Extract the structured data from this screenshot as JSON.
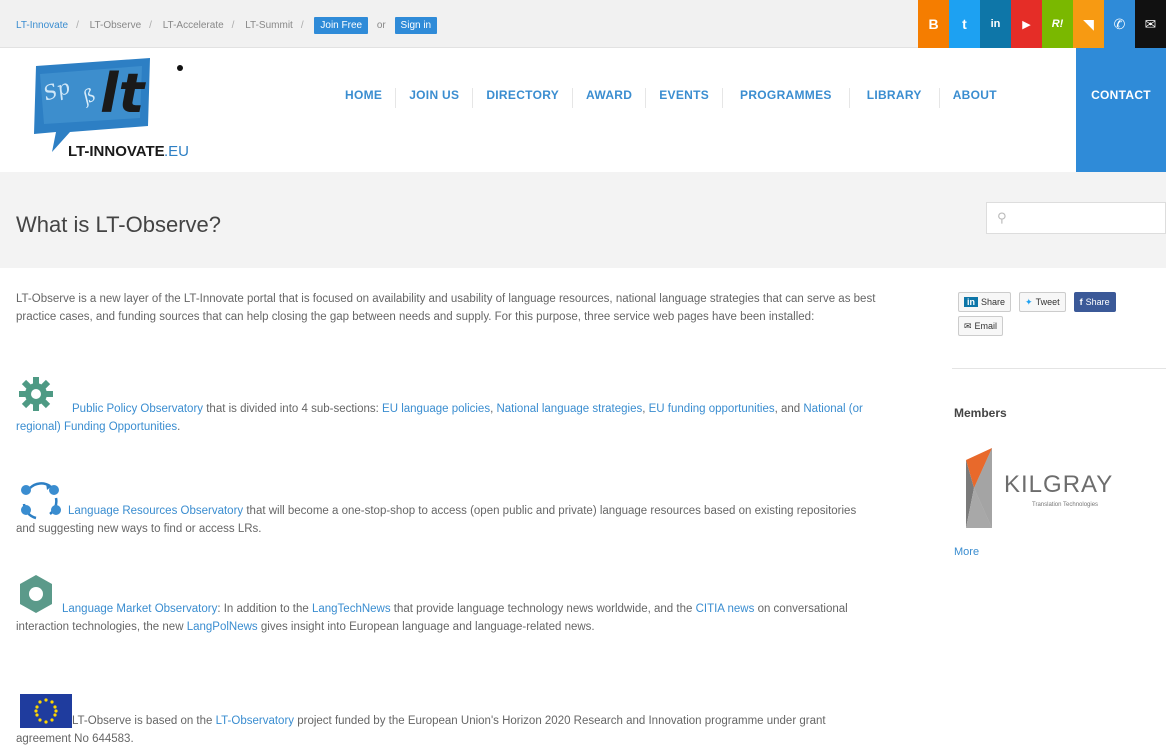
{
  "topbar": {
    "crumbs": [
      "LT-Innovate",
      "LT-Observe",
      "LT-Accelerate",
      "LT-Summit"
    ],
    "join_label": "Join Free",
    "or_label": "or",
    "signin_label": "Sign in",
    "social": [
      {
        "name": "blogger",
        "glyph": "B",
        "color": "#f57d00"
      },
      {
        "name": "twitter",
        "glyph": "t",
        "color": "#1da1f2"
      },
      {
        "name": "linkedin",
        "glyph": "in",
        "color": "#0e76a8"
      },
      {
        "name": "youtube",
        "glyph": "▶",
        "color": "#e52d27"
      },
      {
        "name": "ruby",
        "glyph": "R!",
        "color": "#7ab800"
      },
      {
        "name": "rss",
        "glyph": "◥",
        "color": "#f79a12"
      },
      {
        "name": "phone",
        "glyph": "✆",
        "color": "#2f8bd8"
      },
      {
        "name": "email",
        "glyph": "✉",
        "color": "#111111"
      }
    ]
  },
  "header": {
    "logo_text": "LT-INNOVATE",
    "logo_suffix": ".EU",
    "nav": [
      "HOME",
      "JOIN US",
      "DIRECTORY",
      "AWARD",
      "EVENTS",
      "PROGRAMMES",
      "LIBRARY",
      "ABOUT"
    ],
    "contact_label": "CONTACT"
  },
  "page": {
    "title": "What is LT-Observe?",
    "search_placeholder": ""
  },
  "content": {
    "intro": "LT-Observe is a new layer of the LT-Innovate portal that is focused on availability and usability of language resources, national language strategies that can serve as best practice cases, and funding sources that can help closing the gap between needs and supply. For this purpose, three service web pages have been installed:",
    "ppo": {
      "link": "Public Policy Observatory",
      "text1": " that is divided into 4 sub-sections:  ",
      "l1": "EU language policies",
      "c1": ", ",
      "l2": "National language strategies",
      "c2": ", ",
      "l3": "EU funding opportunities",
      "c3": ", and  ",
      "l4": "National (or regional) Funding Opportunities",
      "c4": "."
    },
    "lro": {
      "link": "Language Resources Observatory",
      "text": " that will become a one-stop-shop to access (open public and private) language resources based on existing repositories and suggesting new ways to find or access LRs."
    },
    "lmo": {
      "link": "Language Market Observatory",
      "t1": ": In addition to the ",
      "l1": "LangTechNews",
      "t2": " that provide language technology news worldwide, and the ",
      "l2": "CITIA news",
      "t3": " on conversational interaction technologies, the new ",
      "l3": "LangPolNews",
      "t4": " gives insight into European language and language-related news."
    },
    "eu": {
      "t1": "LT-Observe is based on the ",
      "l1": "LT-Observatory",
      "t2": " project funded by the European Union's Horizon 2020 Research and Innovation programme under grant agreement No 644583."
    }
  },
  "sidebar": {
    "share_linkedin": "Share",
    "share_tweet": "Tweet",
    "share_facebook": "Share",
    "share_email": "Email",
    "members_heading": "Members",
    "member_logo_text": "KILGRAY",
    "member_logo_sub": "Translation Technologies",
    "more_label": "More"
  },
  "colors": {
    "accent": "#2f8bd8",
    "link": "#3a8dd0",
    "gear": "#4e9a84",
    "kilgray_orange": "#e8692b"
  }
}
